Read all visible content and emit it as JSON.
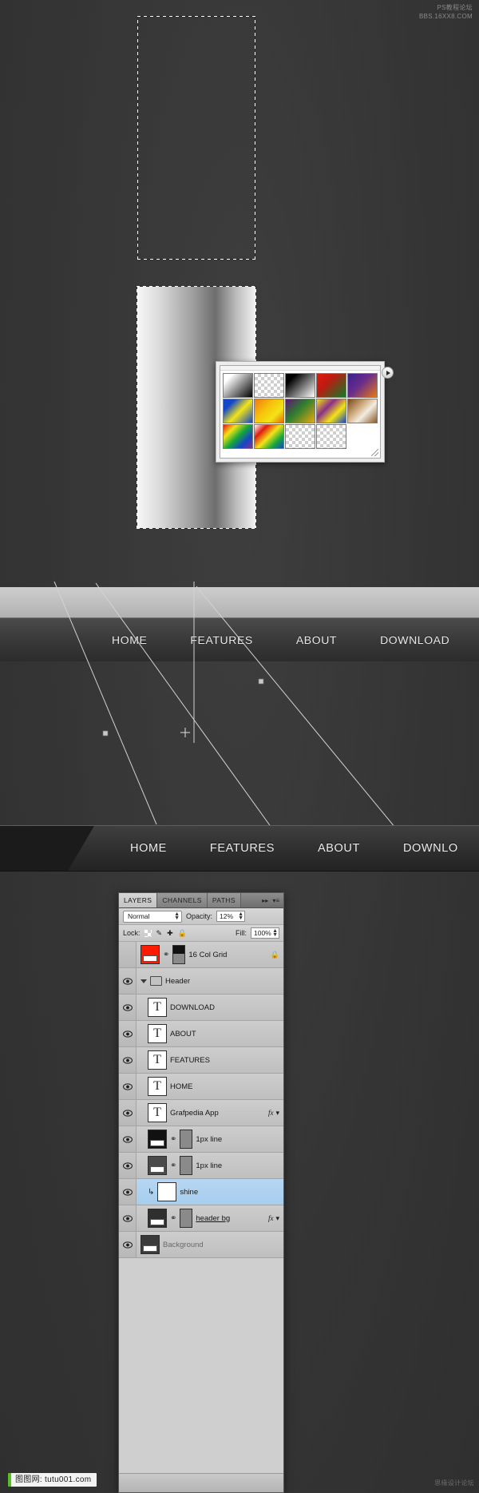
{
  "watermarks": {
    "top_right": "PS教程论坛\nBBS.16XX8.COM",
    "bottom_left": "图图网: tutu001.com",
    "bottom_right": "思缘设计论坛"
  },
  "canvas": {
    "selection_empty_label": "empty-selection",
    "selection_filled_label": "gradient-filled-selection"
  },
  "gradient_picker": {
    "title": "Gradient Picker",
    "swatches": [
      {
        "name": "foreground-to-background",
        "css": "linear-gradient(135deg,#ffffff 0%,#ffffff 18%,#000000 100%)"
      },
      {
        "name": "foreground-to-transparent",
        "css": "checker"
      },
      {
        "name": "black-white",
        "css": "linear-gradient(135deg,#000000 0%,#000000 20%,#ffffff 100%)"
      },
      {
        "name": "red-green",
        "css": "linear-gradient(135deg,#e01b0f 0%,#c01a10 35%,#0f7a2a 100%)"
      },
      {
        "name": "violet-orange",
        "css": "linear-gradient(135deg,#3b1f8f 0%,#6a2d8a 45%,#e77a12 100%)"
      },
      {
        "name": "blue-red-yellow",
        "css": "linear-gradient(135deg,#1446c8 0%,#1446c8 22%,#f2e417 55%,#1446c8 100%)"
      },
      {
        "name": "blue-yellow-blue",
        "css": "linear-gradient(135deg,#f07a10 0%,#f6c20a 40%,#f2e417 70%,#e86a08 100%)"
      },
      {
        "name": "orange-yellow-orange",
        "css": "linear-gradient(135deg,#5b1570 0%,#2f7f2f 45%,#e9a80e 100%)"
      },
      {
        "name": "violet-green-orange",
        "css": "linear-gradient(135deg,#f3e312 0%,#8a2f8a 35%,#f3e312 65%,#1446c8 100%)"
      },
      {
        "name": "yellow-violet-orange-blue",
        "css": "linear-gradient(135deg,#7a4a1a 0%,#d6b48a 40%,#f2ece4 60%,#8a5a22 100%)"
      },
      {
        "name": "copper",
        "css": "linear-gradient(135deg,#e01b0f 0%,#f2e417 25%,#18a83a 50%,#1446c8 75%,#8a2f8a 100%)"
      },
      {
        "name": "spectrum",
        "css": "linear-gradient(135deg,#ffffff 0%,#e01b0f 25%,#f2e417 50%,#18a83a 75%,#1446c8 100%)"
      },
      {
        "name": "transparent-rainbow",
        "css": "checker"
      },
      {
        "name": "transparent-stripes",
        "css": "checker"
      },
      {
        "name": "empty-slot",
        "css": "none"
      }
    ],
    "arrow_button_label": "picker-menu"
  },
  "nav_bar_1": {
    "items": [
      "HOME",
      "FEATURES",
      "ABOUT",
      "DOWNLOAD"
    ]
  },
  "nav_bar_2": {
    "items": [
      "HOME",
      "FEATURES",
      "ABOUT",
      "DOWNLO"
    ]
  },
  "layers_panel": {
    "tabs": [
      {
        "label": "LAYERS",
        "active": true
      },
      {
        "label": "CHANNELS",
        "active": false
      },
      {
        "label": "PATHS",
        "active": false
      }
    ],
    "tab_icons": [
      "▸▸",
      "▾≡"
    ],
    "blend_mode": "Normal",
    "opacity_label": "Opacity:",
    "opacity_value": "12%",
    "lock_label": "Lock:",
    "lock_icons": [
      "transparency-lock",
      "brush-lock",
      "move-lock",
      "all-lock"
    ],
    "fill_label": "Fill:",
    "fill_value": "100%",
    "layers": [
      {
        "name": "16 Col Grid",
        "type": "image",
        "thumb": "#ff1a00",
        "mask": "half-black-gray",
        "linked": true,
        "locked": true,
        "visible": false,
        "fx": false,
        "selected": false,
        "indent": 0
      },
      {
        "name": "Header",
        "type": "group",
        "visible": true,
        "expanded": true,
        "fx": false,
        "selected": false,
        "indent": 0
      },
      {
        "name": "DOWNLOAD",
        "type": "text",
        "visible": true,
        "fx": false,
        "selected": false,
        "indent": 1
      },
      {
        "name": "ABOUT",
        "type": "text",
        "visible": true,
        "fx": false,
        "selected": false,
        "indent": 1
      },
      {
        "name": "FEATURES",
        "type": "text",
        "visible": true,
        "fx": false,
        "selected": false,
        "indent": 1
      },
      {
        "name": "HOME",
        "type": "text",
        "visible": true,
        "fx": false,
        "selected": false,
        "indent": 1
      },
      {
        "name": "Grafpedia App",
        "type": "text",
        "visible": true,
        "fx": true,
        "selected": false,
        "indent": 1
      },
      {
        "name": "1px line",
        "type": "image",
        "thumb": "#111111",
        "mask": "gray",
        "linked": true,
        "visible": true,
        "fx": false,
        "selected": false,
        "indent": 1
      },
      {
        "name": "1px line",
        "type": "image",
        "thumb": "#4a4a4a",
        "mask": "gray",
        "linked": true,
        "visible": true,
        "fx": false,
        "selected": false,
        "indent": 1
      },
      {
        "name": "shine",
        "type": "clipped",
        "visible": true,
        "fx": false,
        "selected": true,
        "indent": 1
      },
      {
        "name": "header bg",
        "type": "image",
        "thumb": "#2f2f2f",
        "mask": "gray",
        "linked": true,
        "visible": true,
        "fx": true,
        "selected": false,
        "indent": 1
      },
      {
        "name": "Background",
        "type": "image",
        "thumb": "#3a3a3a",
        "visible": true,
        "fx": false,
        "selected": false,
        "indent": 0
      }
    ]
  }
}
